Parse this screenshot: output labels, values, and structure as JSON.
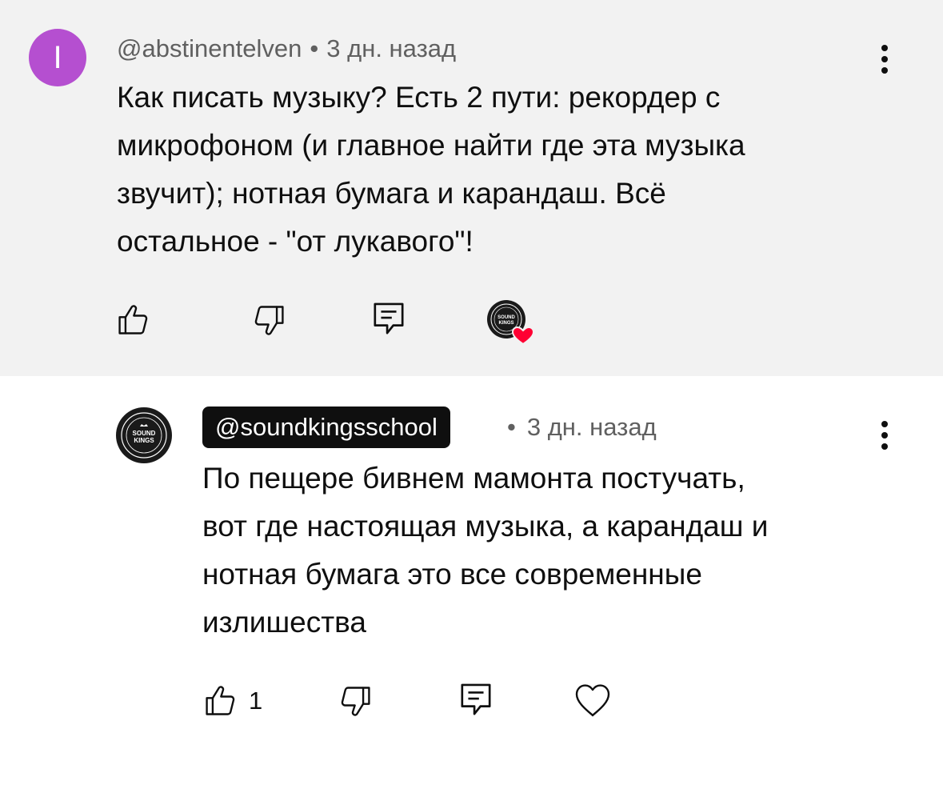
{
  "comment": {
    "author": "@abstinentelven",
    "avatar_letter": "I",
    "avatar_color": "#b54fd0",
    "separator": "•",
    "time": "3 дн. назад",
    "text_lines": [
      "Как писать музыку? Есть 2 пути: рекордер с",
      "микрофоном (и главное найти где эта музыка",
      "звучит); нотная бумага и карандаш. Всё",
      "остальное - \"от лукавого\"!"
    ],
    "actions": {
      "like_icon": "thumbs-up-icon",
      "dislike_icon": "thumbs-down-icon",
      "reply_icon": "reply-comment-icon",
      "creator_heart_icon": "creator-heart-icon"
    },
    "background": "#f2f2f2"
  },
  "reply": {
    "author": "@soundkingsschool",
    "avatar_text": [
      "SOUND",
      "KINGS"
    ],
    "separator": "•",
    "time": "3 дн. назад",
    "text_lines": [
      "По пещере бивнем мамонта постучать,",
      "вот где настоящая музыка, а карандаш и",
      "нотная бумага это все современные",
      "излишества"
    ],
    "like_count": "1",
    "actions": {
      "like_icon": "thumbs-up-icon",
      "dislike_icon": "thumbs-down-icon",
      "reply_icon": "reply-comment-icon",
      "heart_icon": "heart-outline-icon"
    }
  },
  "colors": {
    "heart": "#ff0033",
    "text": "#0f0f0f",
    "meta": "#606060"
  }
}
